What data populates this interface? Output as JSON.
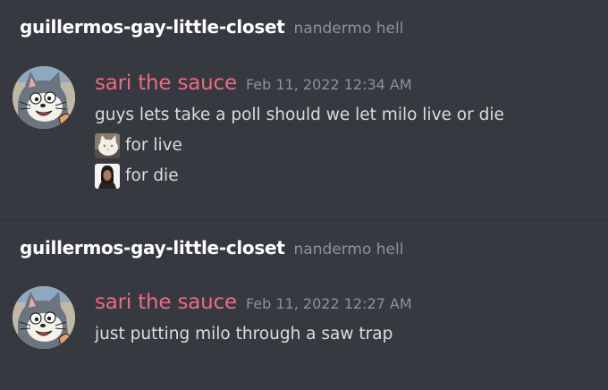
{
  "blocks": [
    {
      "channel": "guillermos-gay-little-closet",
      "server": "nandermo hell",
      "username": "sari the sauce",
      "timestamp": "Feb 11, 2022 12:34 AM",
      "lines": [
        "guys lets take a poll should we let milo live or die",
        "for live",
        "for die"
      ]
    },
    {
      "channel": "guillermos-gay-little-closet",
      "server": "nandermo hell",
      "username": "sari the sauce",
      "timestamp": "Feb 11, 2022 12:27 AM",
      "lines": [
        "just putting milo through a saw trap"
      ]
    }
  ],
  "colors": {
    "background": "#36393f",
    "username": "#ee6a84",
    "channel": "#ffffff",
    "muted": "#8e9297",
    "text": "#dcddde"
  },
  "icons": {
    "avatar": "cartoon-cat-avatar",
    "emoji_live": "white-cat-emoji",
    "emoji_die": "man-portrait-emoji"
  }
}
